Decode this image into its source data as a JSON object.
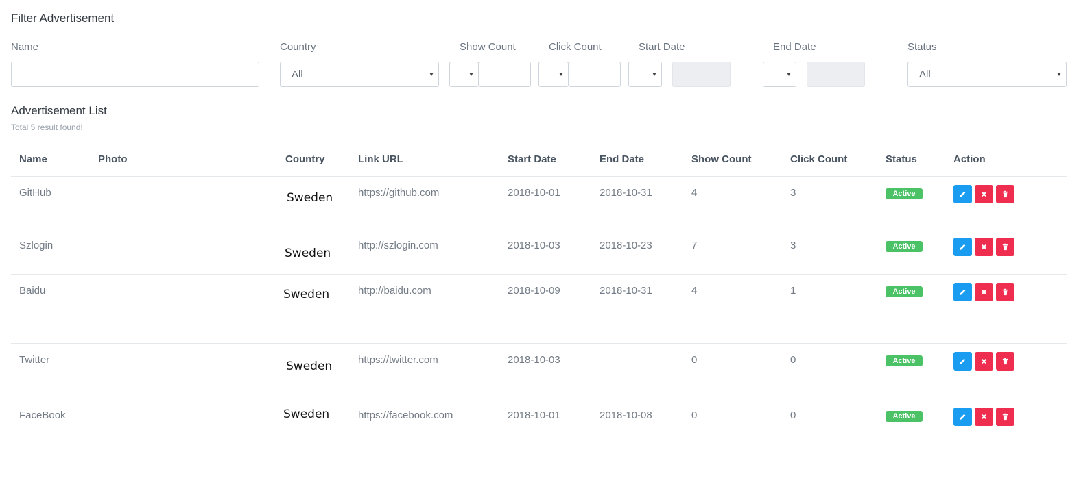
{
  "filter": {
    "title": "Filter Advertisement",
    "labels": {
      "name": "Name",
      "country": "Country",
      "show_count": "Show Count",
      "click_count": "Click Count",
      "start_date": "Start Date",
      "end_date": "End Date",
      "status": "Status"
    },
    "values": {
      "name": "",
      "country": "All",
      "show_count_operator": "",
      "show_count": "",
      "click_count_operator": "",
      "click_count": "",
      "start_date_operator": "",
      "start_date": "",
      "end_date_operator": "",
      "end_date": "",
      "status": "All"
    }
  },
  "list": {
    "title": "Advertisement List",
    "subtitle": "Total 5 result found!",
    "columns": {
      "name": "Name",
      "photo": "Photo",
      "country": "Country",
      "link_url": "Link URL",
      "start_date": "Start Date",
      "end_date": "End Date",
      "show_count": "Show Count",
      "click_count": "Click Count",
      "status": "Status",
      "action": "Action"
    },
    "rows": [
      {
        "name": "GitHub",
        "country": "Sweden",
        "link_url": "https://github.com",
        "start_date": "2018-10-01",
        "end_date": "2018-10-31",
        "show_count": "4",
        "click_count": "3",
        "status": "Active"
      },
      {
        "name": "Szlogin",
        "country": "Sweden",
        "link_url": "http://szlogin.com",
        "start_date": "2018-10-03",
        "end_date": "2018-10-23",
        "show_count": "7",
        "click_count": "3",
        "status": "Active"
      },
      {
        "name": "Baidu",
        "country": "Sweden",
        "link_url": "http://baidu.com",
        "start_date": "2018-10-09",
        "end_date": "2018-10-31",
        "show_count": "4",
        "click_count": "1",
        "status": "Active"
      },
      {
        "name": "Twitter",
        "country": "Sweden",
        "link_url": "https://twitter.com",
        "start_date": "2018-10-03",
        "end_date": "",
        "show_count": "0",
        "click_count": "0",
        "status": "Active"
      },
      {
        "name": "FaceBook",
        "country": "Sweden",
        "link_url": "https://facebook.com",
        "start_date": "2018-10-01",
        "end_date": "2018-10-08",
        "show_count": "0",
        "click_count": "0",
        "status": "Active"
      }
    ]
  },
  "icons": {
    "edit": "pencil-icon",
    "cancel": "x-icon",
    "delete": "trash-icon"
  },
  "colors": {
    "active_badge": "#4cc266",
    "edit_button": "#1a9df0",
    "danger_button": "#ef2d4f"
  }
}
